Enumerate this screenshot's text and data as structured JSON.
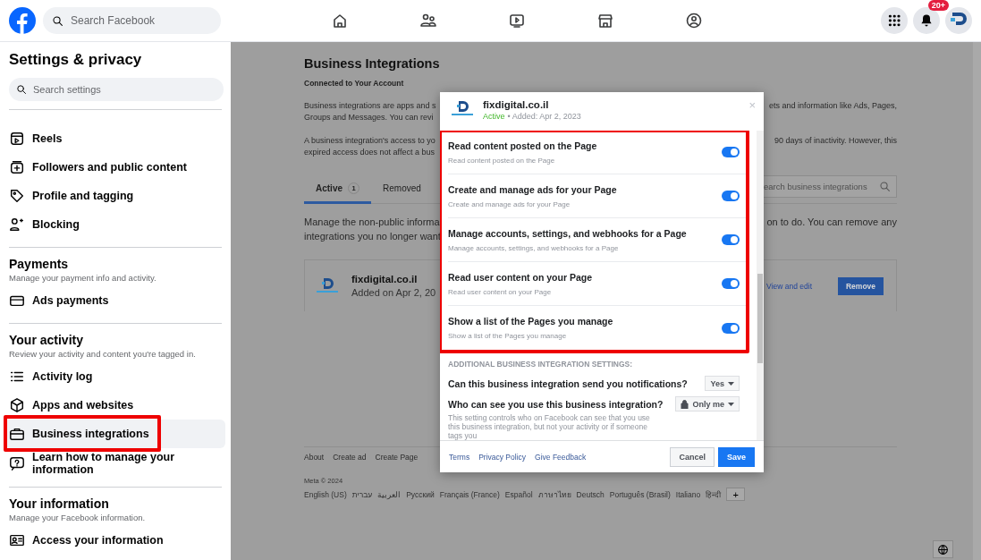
{
  "top_bar": {
    "search_placeholder": "Search Facebook",
    "notification_badge": "20+"
  },
  "sidebar": {
    "title": "Settings & privacy",
    "search_placeholder": "Search settings",
    "sections": [
      {
        "items": [
          {
            "label": "Reels",
            "selected": false,
            "highlighted": false
          },
          {
            "label": "Followers and public content",
            "selected": false,
            "highlighted": false
          },
          {
            "label": "Profile and tagging",
            "selected": false,
            "highlighted": false
          },
          {
            "label": "Blocking",
            "selected": false,
            "highlighted": false
          }
        ]
      },
      {
        "heading": "Payments",
        "subheading": "Manage your payment info and activity.",
        "items": [
          {
            "label": "Ads payments",
            "selected": false,
            "highlighted": false
          }
        ]
      },
      {
        "heading": "Your activity",
        "subheading": "Review your activity and content you're tagged in.",
        "items": [
          {
            "label": "Activity log",
            "selected": false,
            "highlighted": false
          },
          {
            "label": "Apps and websites",
            "selected": false,
            "highlighted": false
          },
          {
            "label": "Business integrations",
            "selected": true,
            "highlighted": true
          },
          {
            "label": "Learn how to manage your information",
            "selected": false,
            "highlighted": false
          }
        ]
      },
      {
        "heading": "Your information",
        "subheading": "Manage your Facebook information.",
        "items": [
          {
            "label": "Access your information",
            "selected": false,
            "highlighted": false
          }
        ]
      }
    ]
  },
  "page": {
    "title": "Business Integrations",
    "subtitle": "Connected to Your Account",
    "paragraphs": [
      {
        "left": [
          "Business integrations are apps and s",
          "Groups and Messages. You can revi"
        ],
        "right": [
          "ets and information like Ads, Pages,"
        ]
      },
      {
        "left": [
          "A business integration's access to yo",
          "expired access does not affect a bus"
        ],
        "right": [
          "90 days of inactivity. However, this"
        ]
      }
    ],
    "tabs": [
      {
        "label": "Active",
        "count": "1",
        "selected": true
      },
      {
        "label": "Removed",
        "selected": false
      }
    ],
    "search_placeholder": "earch business integrations",
    "note": {
      "left": [
        "Manage the non-public informa",
        "integrations you no longer want"
      ],
      "right": [
        "on to do. You can remove any"
      ]
    },
    "integration": {
      "name": "fixdigital.co.il",
      "added": "Added on Apr 2, 20",
      "view_link": "View and edit",
      "remove_button": "Remove"
    },
    "footer": {
      "links": [
        "About",
        "Create ad",
        "Create Page"
      ],
      "copyright": "Meta © 2024",
      "languages": [
        "English (US)",
        "עברית",
        "العربية",
        "Русский",
        "Français (France)",
        "Español",
        "ภาษาไทย",
        "Deutsch",
        "Português (Brasil)",
        "Italiano",
        "हिन्दी"
      ],
      "more_button": "+"
    }
  },
  "dialog": {
    "name": "fixdigital.co.il",
    "status": "Active",
    "added": "• Added: Apr 2, 2023",
    "close": "×",
    "permissions_highlighted": true,
    "permissions": [
      {
        "title": "Read content posted on the Page",
        "description": "Read content posted on the Page",
        "on": true
      },
      {
        "title": "Create and manage ads for your Page",
        "description": "Create and manage ads for your Page",
        "on": true
      },
      {
        "title": "Manage accounts, settings, and webhooks for a Page",
        "description": "Manage accounts, settings, and webhooks for a Page",
        "on": true
      },
      {
        "title": "Read user content on your Page",
        "description": "Read user content on your Page",
        "on": true
      },
      {
        "title": "Show a list of the Pages you manage",
        "description": "Show a list of the Pages you manage",
        "on": true
      }
    ],
    "additional_heading": "ADDITIONAL BUSINESS INTEGRATION SETTINGS:",
    "settings": [
      {
        "kind": "plain",
        "question": "Can this business integration send you notifications?",
        "value": "Yes"
      },
      {
        "kind": "privacy",
        "question": "Who can see you use this business integration?",
        "value": "Only me",
        "description": "This setting controls who on Facebook can see that you use this business integration, but not your activity or if someone tags you"
      }
    ],
    "links": [
      "Terms",
      "Privacy Policy",
      "Give Feedback"
    ],
    "cancel_button": "Cancel",
    "save_button": "Save"
  }
}
